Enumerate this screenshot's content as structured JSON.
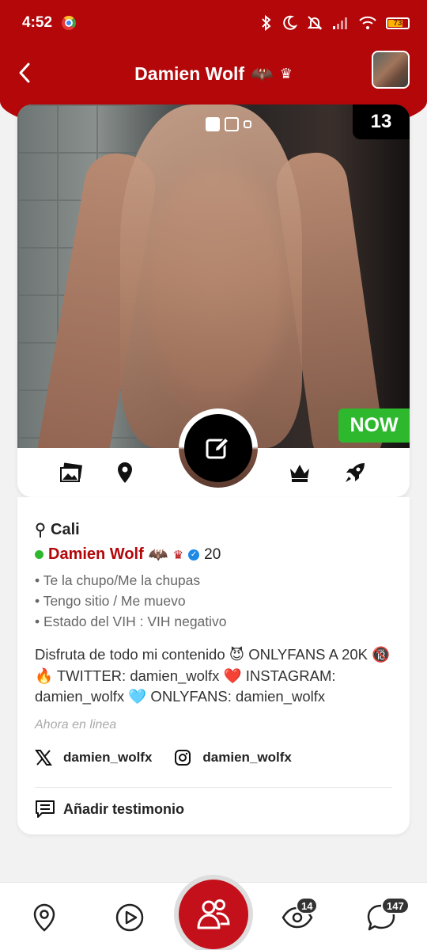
{
  "status_bar": {
    "time": "4:52",
    "battery": "73"
  },
  "header": {
    "title": "Damien Wolf",
    "title_emoji": "🦇",
    "crown": "♛"
  },
  "profile": {
    "photo_count": "13",
    "status_badge": "NOW",
    "carousel_active_index": 0
  },
  "info": {
    "location": "Cali",
    "name": "Damien Wolf",
    "name_emoji": "🦇",
    "crown": "♛",
    "verified": "✓",
    "age": "20",
    "traits": [
      "Te la chupo/Me la chupas",
      "Tengo sitio / Me muevo",
      "Estado del VIH : VIH negativo"
    ],
    "bio": "Disfruta de todo mi contenido 😈 ONLYFANS A 20K 🔞 🔥 TWITTER: damien_wolfx ❤️ INSTAGRAM: damien_wolfx 🩵 ONLYFANS: damien_wolfx",
    "last_seen": "Ahora en linea",
    "twitter_handle": "damien_wolfx",
    "instagram_handle": "damien_wolfx",
    "add_testimonial": "Añadir testimonio"
  },
  "bottom_nav": {
    "views_badge": "14",
    "messages_badge": "147"
  },
  "colors": {
    "brand_red": "#b3070a",
    "online_green": "#2eb82e"
  }
}
